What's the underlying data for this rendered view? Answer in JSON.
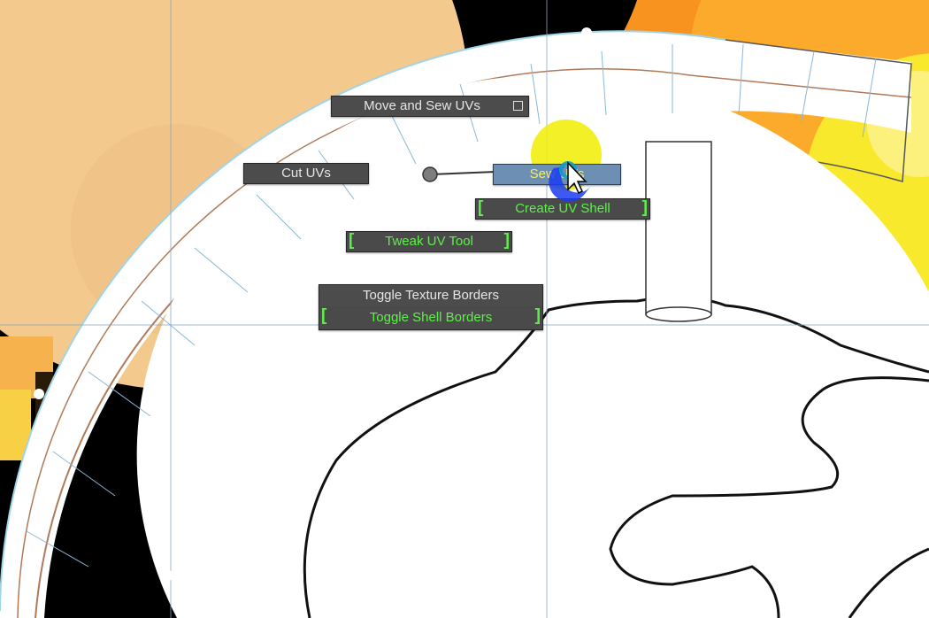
{
  "viewport": {
    "name": "uv-editor-viewport",
    "background_colors": {
      "left_sphere": "#f3c98e",
      "right_sphere": "#f9a23a",
      "space": "#000000",
      "ring": "#ffffff",
      "gridlines": "#8ab8d6",
      "texture_border": "#b07a58"
    }
  },
  "marking_menu": {
    "items": {
      "move_and_sew": "Move and Sew UVs",
      "cut_uvs": "Cut UVs",
      "sew_uvs": "Sew UVs",
      "create_uv_shell": "Create UV Shell",
      "tweak_uv_tool": "Tweak UV Tool",
      "toggle_texture_borders": "Toggle Texture Borders",
      "toggle_shell_borders": "Toggle Shell Borders"
    },
    "highlighted_item": "sew_uvs",
    "bracket_open": "[",
    "bracket_close": "]",
    "colors": {
      "item_bg": "#4c4c4c",
      "item_text": "#e6e6e6",
      "green_text": "#5ef04a",
      "highlight_bg": "#6e8fb4",
      "highlight_text": "#f0f070",
      "click_indicator": "#f2ee10",
      "cursor_ring": "#1a3cf5"
    }
  }
}
